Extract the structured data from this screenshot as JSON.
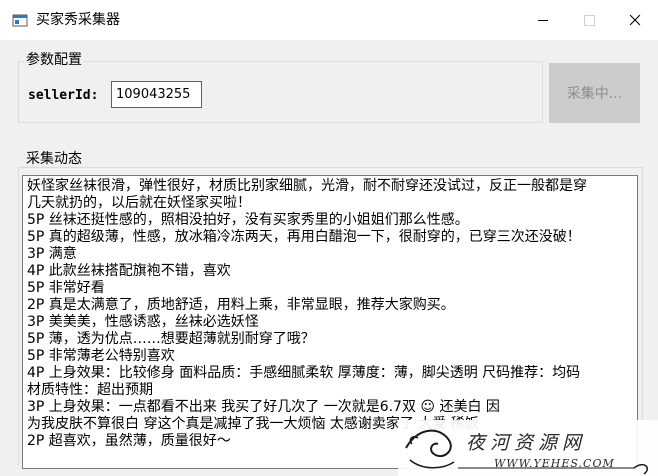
{
  "window": {
    "title": "买家秀采集器",
    "icons": {
      "app": "app-window-icon",
      "minimize": "minimize-icon",
      "maximize": "maximize-icon",
      "close": "close-icon"
    }
  },
  "params": {
    "group_label": "参数配置",
    "seller_label": "sellerId:",
    "seller_value": "109043255",
    "collect_button": "采集中..."
  },
  "dynamics": {
    "group_label": "采集动态",
    "lines": [
      "妖怪家丝袜很滑，弹性很好，材质比别家细腻，光滑，耐不耐穿还没试过，反正一般都是穿",
      "几天就扔的，以后就在妖怪家买啦！",
      "5P 丝袜还挺性感的，照相没拍好，没有买家秀里的小姐姐们那么性感。",
      "5P 真的超级薄，性感，放冰箱冷冻两天，再用白醋泡一下，很耐穿的，已穿三次还没破！",
      "3P 满意",
      "4P 此款丝袜搭配旗袍不错，喜欢",
      "5P 非常好看",
      "2P 真是太满意了，质地舒适，用料上乘，非常显眼，推荐大家购买。",
      "3P 美美美，性感诱惑，丝袜必选妖怪",
      "5P 薄，透为优点……想要超薄就别耐穿了哦？",
      "5P 非常薄老公特别喜欢",
      "4P 上身效果：比较修身 面料品质：手感细腻柔软 厚薄度：薄，脚尖透明 尺码推荐：均码",
      "材质特性：超出预期",
      "3P 上身效果：一点都看不出来     我买了好几次了   一次就是6.7双  ☺    还美白      因",
      "为我皮肤不算很白     穿这个真是减掉了我一大烦恼     太感谢卖家了   大爱    稀饭",
      "2P 超喜欢，虽然薄，质量很好～"
    ]
  },
  "watermark": {
    "text": "夜河资源网",
    "url": "WWW.YEHES.COM",
    "icon": "ornament-icon"
  }
}
